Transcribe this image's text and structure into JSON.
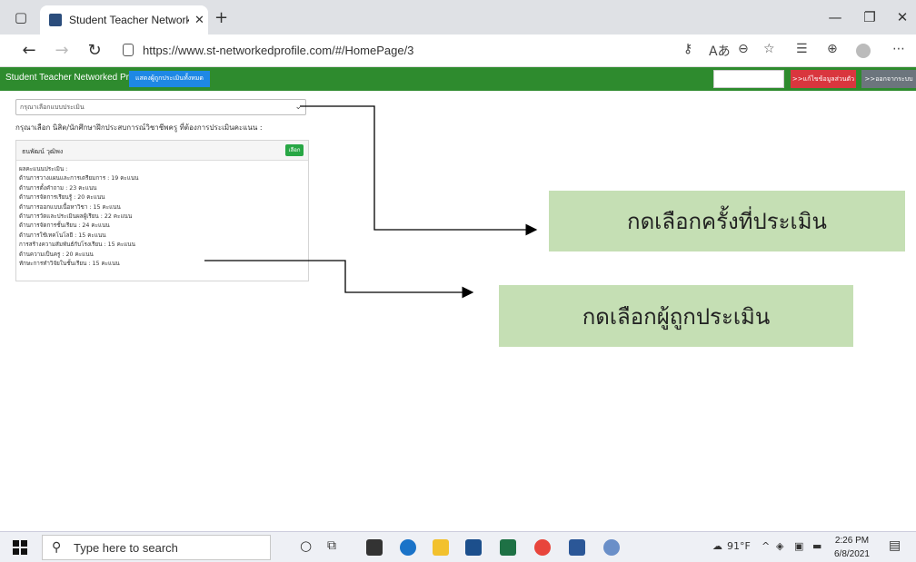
{
  "browser": {
    "tab_title": "Student Teacher Networked Prof",
    "tab_close": "✕",
    "new_tab": "+",
    "url": "https://www.st-networkedprofile.com/#/HomePage/3",
    "window_controls": {
      "minimize": "—",
      "restore": "❐",
      "close": "✕"
    }
  },
  "app": {
    "brand": "Student Teacher Networked Profile",
    "show_all_button": "แสดงผู้ถูกประเมินทั้งหมด",
    "edit_button": ">>แก้ไขข้อมูลส่วนตัว",
    "logout_button": ">>ออกจากระบบ",
    "round_select_placeholder": "กรุณาเลือกแบบประเมิน",
    "instruction": "กรุณาเลือก นิสิต/นักศึกษาฝึกประสบการณ์วิชาชีพครู ที่ต้องการประเมินคะแนน :",
    "card": {
      "name": "ธนพัฒน์ วุฒิพง",
      "select_button": "เลือก",
      "scores": [
        "ผลคะแนนประเมิน :",
        "ด้านการวางแผนและการเตรียมการ : 19 คะแนน",
        "ด้านการตั้งคำถาม : 23 คะแนน",
        "ด้านการจัดการเรียนรู้ : 20 คะแนน",
        "ด้านการออกแบบเนื้อหาวิชา : 15 คะแนน",
        "ด้านการวัดและประเมินผลผู้เรียน : 22 คะแนน",
        "ด้านการจัดการชั้นเรียน : 24 คะแนน",
        "ด้านการใช้เทคโนโลยี : 15 คะแนน",
        "การสร้างความสัมพันธ์กับโรงเรียน : 15 คะแนน",
        "ด้านความเป็นครู : 20 คะแนน",
        "ทักษะการทำวิจัยในชั้นเรียน : 15 คะแนน"
      ]
    }
  },
  "annotations": {
    "callout_round": "กดเลือกครั้งที่ประเมิน",
    "callout_person": "กดเลือกผู้ถูกประเมิน"
  },
  "taskbar": {
    "search_placeholder": "Type here to search",
    "temperature": "91°F",
    "time": "2:26 PM",
    "date": "6/8/2021"
  },
  "colors": {
    "appbar": "#2e8b2e",
    "callout": "#c5dfb4",
    "show_all": "#1e88e5",
    "edit": "#d9363e",
    "logout": "#6c757d"
  }
}
